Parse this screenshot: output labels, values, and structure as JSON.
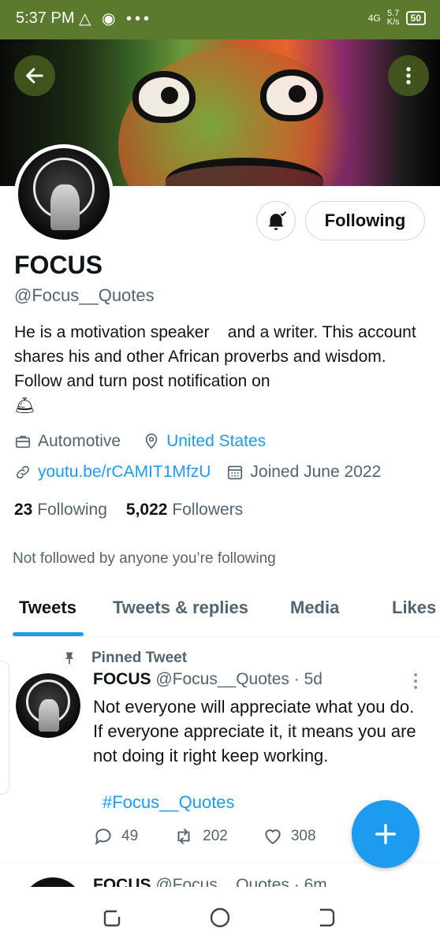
{
  "status_bar": {
    "time": "5:37 PM",
    "net_type": "4G",
    "net_speed_top": "5.7",
    "net_speed_bottom": "K/s",
    "battery": "50"
  },
  "profile": {
    "name": "FOCUS",
    "handle": "@Focus__Quotes",
    "bio": "He is a motivation speaker    and a writer. This account shares his and other African proverbs and wisdom. Follow and turn post notification on",
    "bio_emoji": "🛎",
    "category": "Automotive",
    "location": "United States",
    "website": "youtu.be/rCAMIT1MfzU",
    "joined": "Joined June 2022",
    "following_count": "23",
    "following_label": "Following",
    "followers_count": "5,022",
    "followers_label": "Followers",
    "not_followed_note": "Not followed by anyone you’re following",
    "follow_button_label": "Following"
  },
  "tabs": [
    {
      "label": "Tweets",
      "active": true
    },
    {
      "label": "Tweets & replies",
      "active": false
    },
    {
      "label": "Media",
      "active": false
    },
    {
      "label": "Likes",
      "active": false
    }
  ],
  "pinned_tweet": {
    "pinned_label": "Pinned Tweet",
    "author_name": "FOCUS",
    "author_handle": "@Focus__Quotes",
    "time": "· 5d",
    "text": "Not everyone will appreciate what you do. If everyone appreciate it, it means you are not doing it right keep working.",
    "hashtag": "#Focus__Quotes",
    "replies": "49",
    "retweets": "202",
    "likes": "308"
  },
  "next_tweet": {
    "author_name": "FOCUS",
    "author_handle": "@Focus__Quotes",
    "time": "· 6m"
  },
  "colors": {
    "accent": "#1d9bf0",
    "status_bar": "#5b7a2e",
    "text": "#0f1419",
    "secondary": "#536471"
  },
  "icons": [
    "arrow-left-icon",
    "more-vertical-icon",
    "bell-check-icon",
    "briefcase-icon",
    "location-pin-icon",
    "link-icon",
    "calendar-icon",
    "pin-icon",
    "reply-icon",
    "retweet-icon",
    "heart-icon",
    "plus-icon"
  ]
}
